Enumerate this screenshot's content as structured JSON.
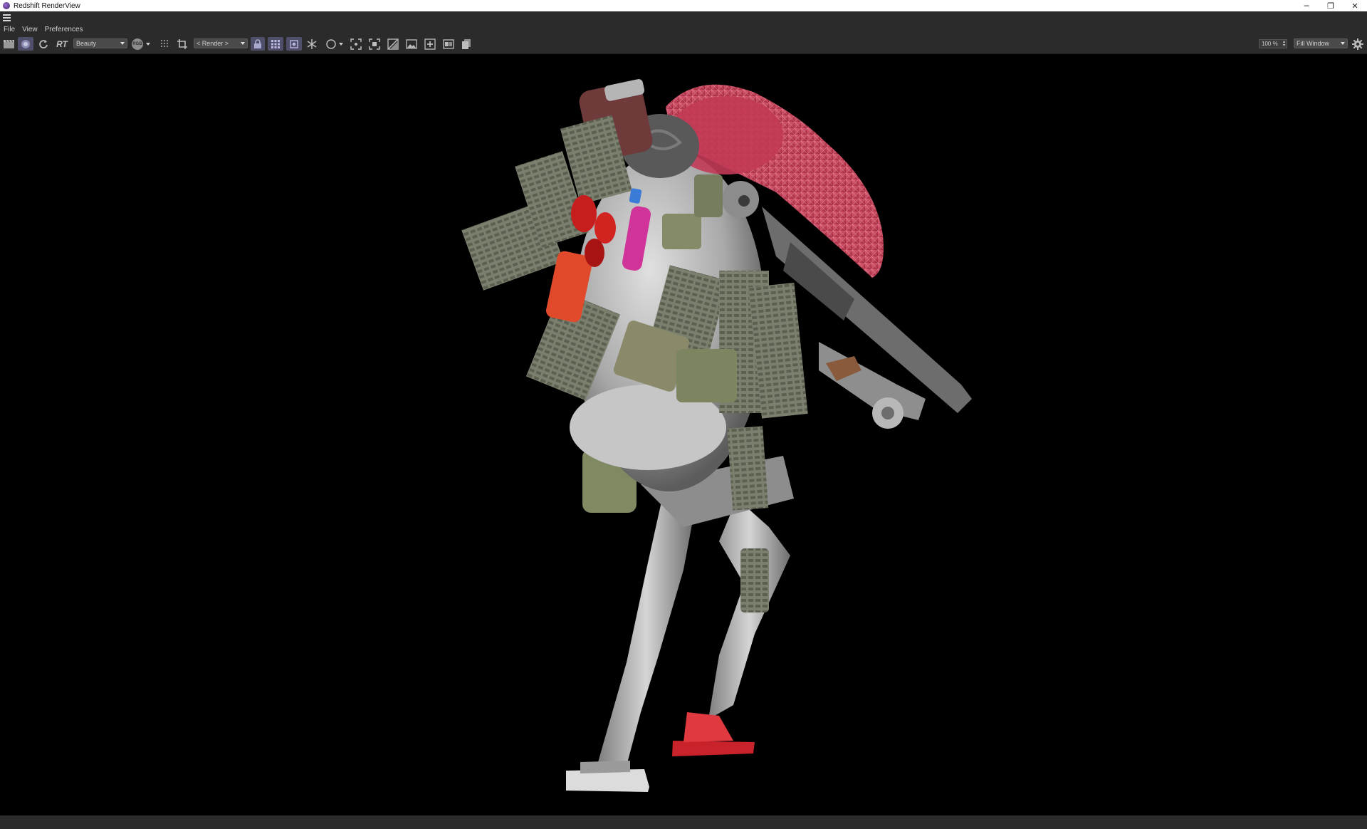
{
  "window": {
    "title": "Redshift RenderView",
    "controls": {
      "minimize": "─",
      "restore": "❐",
      "close": "✕"
    }
  },
  "menu": {
    "items": [
      "File",
      "View",
      "Preferences"
    ]
  },
  "toolbar": {
    "rt_label": "RT",
    "aov_select": "Beauty",
    "channel_badge": "RGB",
    "camera_select": "< Render >",
    "zoom_value": "100 %",
    "fit_select": "Fill Window"
  },
  "colors": {
    "chrome": "#2b2b2b",
    "viewport": "#000000",
    "hat": "#c23a55",
    "robot_body": "#b9b9b9",
    "gear_green": "#6f7563",
    "red_block": "#c8232a"
  }
}
